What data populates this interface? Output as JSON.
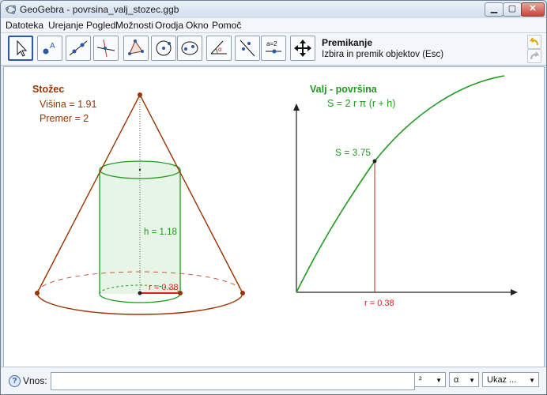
{
  "window": {
    "title": "GeoGebra - povrsina_valj_stozec.ggb"
  },
  "menu": [
    "Datoteka",
    "Urejanje",
    "Pogled",
    "Možnosti",
    "Orodja",
    "Okno",
    "Pomoč"
  ],
  "toolbar": {
    "tool_name": "Premikanje",
    "tool_help": "Izbira in premik objektov (Esc)",
    "tools": [
      "move-tool",
      "point-tool",
      "line-tool",
      "perpendicular-tool",
      "polygon-tool",
      "circle-tool",
      "conic-tool",
      "angle-tool",
      "reflect-tool",
      "slider-tool",
      "move-view-tool"
    ]
  },
  "cone_panel": {
    "title": "Stožec",
    "height_text": "Višina = 1.91",
    "diameter_text": "Premer = 2",
    "h_label": "h = 1.18",
    "r_label": "r = 0.38"
  },
  "graph_panel": {
    "title": "Valj - površina",
    "formula": "S = 2 r π (r + h)",
    "s_label": "S = 3.75",
    "r_axis_label": "r = 0.38"
  },
  "inputbar": {
    "label": "Vnos:",
    "value": "",
    "superscript_combo": "²",
    "greek_combo": "α",
    "command_combo": "Ukaz ..."
  },
  "colors": {
    "cone": "#993300",
    "cylinder": "#1f9a1f",
    "cylinder_fill": "#e6f5e6",
    "graph_curve": "#1f9a1f",
    "radius_marker": "#e01e1e"
  }
}
